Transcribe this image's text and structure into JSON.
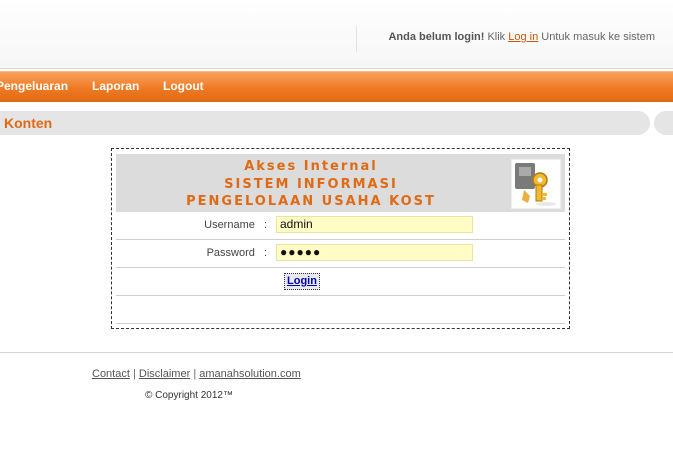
{
  "header": {
    "status_bold": "Anda belum login!",
    "status_prefix": "Klik",
    "login_link": "Log in",
    "status_suffix": "Untuk masuk ke sistem"
  },
  "nav": {
    "items": [
      "Pengeluaran",
      "Laporan",
      "Logout"
    ]
  },
  "content": {
    "title": "Konten"
  },
  "login": {
    "line1": "Akses Internal",
    "line2": "SISTEM INFORMASI",
    "line3": "PENGELOLAAN USAHA KOST",
    "username_label": "Username",
    "password_label": "Password",
    "separator": ":",
    "username_value": "admin",
    "password_value": "●●●●●",
    "button_label": "Login"
  },
  "footer": {
    "links": [
      "Contact",
      "Disclaimer",
      "amanahsolution.com"
    ],
    "separator": "|",
    "copyright": "© Copyright 2012™"
  },
  "colors": {
    "accent": "#ef7a24",
    "title_orange": "#e06a14",
    "input_bg": "#fffcc6"
  }
}
